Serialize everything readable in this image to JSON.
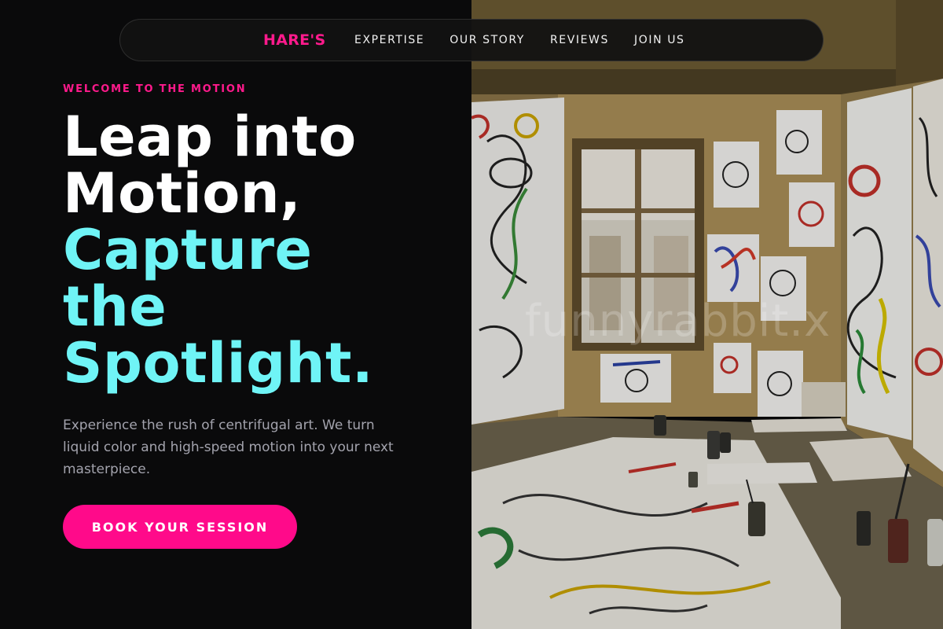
{
  "nav": {
    "brand": "HARE'S",
    "links": [
      "EXPERTISE",
      "OUR STORY",
      "REVIEWS",
      "JOIN US"
    ]
  },
  "hero": {
    "eyebrow": "WELCOME TO THE MOTION",
    "headline_white": [
      "Leap into",
      "Motion,"
    ],
    "headline_cyan": [
      "Capture",
      "the",
      "Spotlight."
    ],
    "description": "Experience the rush of centrifugal art. We turn liquid color and high-speed motion into your next masterpiece.",
    "cta_label": "BOOK YOUR SESSION"
  },
  "image": {
    "watermark": "funnyrabbit.x"
  },
  "colors": {
    "accent_pink": "#ff0a8a",
    "accent_cyan": "#6ff4f6",
    "background": "#0a0a0b"
  }
}
